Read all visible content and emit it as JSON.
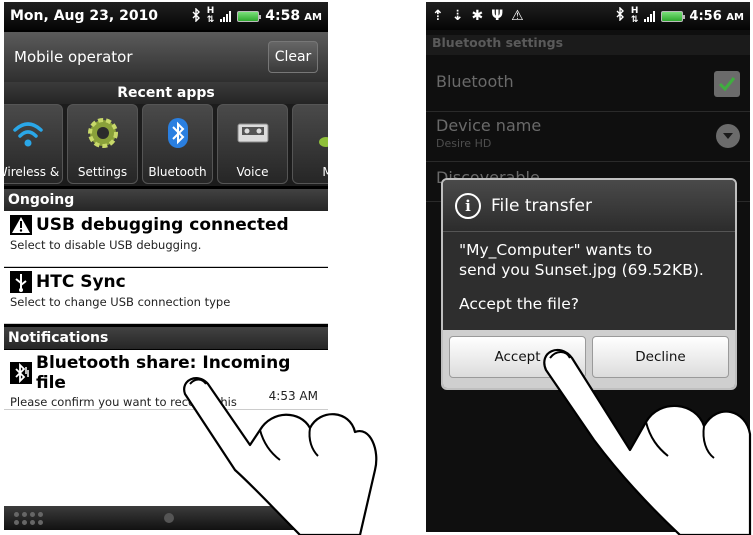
{
  "left": {
    "status_bar": {
      "date": "Mon, Aug 23, 2010",
      "time": "4:58",
      "ampm": "AM"
    },
    "operator": {
      "label": "Mobile operator",
      "clear_label": "Clear"
    },
    "recent_apps": {
      "title": "Recent apps",
      "items": [
        {
          "label": "Wireless &",
          "icon": "wifi-icon"
        },
        {
          "label": "Settings",
          "icon": "gear-icon"
        },
        {
          "label": "Bluetooth",
          "icon": "bluetooth-icon"
        },
        {
          "label": "Voice",
          "icon": "tape-icon"
        },
        {
          "label": "M",
          "icon": "music-note-icon"
        }
      ]
    },
    "ongoing": {
      "title": "Ongoing",
      "items": [
        {
          "title": "USB debugging connected",
          "subtitle": "Select to disable USB debugging."
        },
        {
          "title": "HTC Sync",
          "subtitle": "Select to change USB connection type"
        }
      ]
    },
    "notifications": {
      "title": "Notifications",
      "items": [
        {
          "title": "Bluetooth share: Incoming file",
          "subtitle": "Please confirm you want to receive this",
          "time": "4:53 AM"
        }
      ]
    }
  },
  "right": {
    "status_bar": {
      "time": "4:56",
      "ampm": "AM"
    },
    "settings": {
      "header": "Bluetooth settings",
      "rows": [
        {
          "title": "Bluetooth"
        },
        {
          "title": "Device name",
          "subtitle": "Desire HD"
        },
        {
          "title": "Discoverable"
        }
      ]
    },
    "dialog": {
      "title": "File transfer",
      "message_line1": "\"My_Computer\" wants to",
      "message_line2": "send you Sunset.jpg (69.52KB).",
      "question": "Accept the file?",
      "accept_label": "Accept",
      "decline_label": "Decline"
    }
  }
}
